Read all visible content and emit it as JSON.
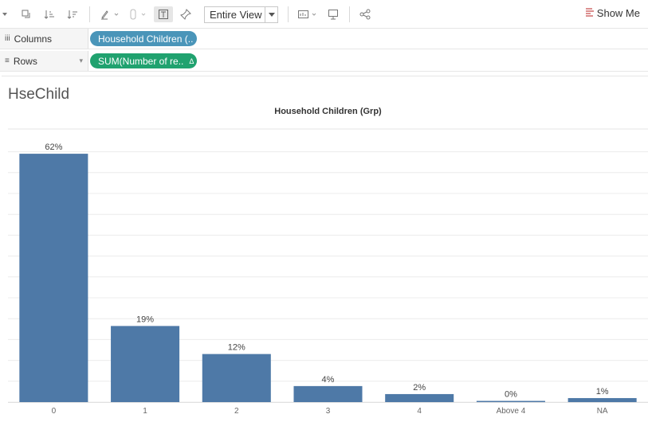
{
  "toolbar": {
    "view_select": "Entire View",
    "show_me": "Show Me",
    "icons": [
      "swap-icon",
      "sort-ascending-icon",
      "sort-descending-icon",
      "highlight-icon",
      "group-icon",
      "label-icon",
      "pin-icon",
      "view-select-icon",
      "presentation-icon",
      "share-icon"
    ]
  },
  "shelves": {
    "columns": {
      "label": "Columns",
      "pill": "Household Children (.."
    },
    "rows": {
      "label": "Rows",
      "pill": "SUM(Number of re..",
      "pill_badge": "Δ"
    }
  },
  "sheet": {
    "title": "HseChild",
    "header": "Household Children (Grp)"
  },
  "colors": {
    "bar": "#4e79a7",
    "pill_blue": "#4a95b9",
    "pill_green": "#20a26f"
  },
  "chart_data": {
    "type": "bar",
    "title": "HseChild",
    "xlabel": "Household Children (Grp)",
    "ylabel": "",
    "categories": [
      "0",
      "1",
      "2",
      "3",
      "4",
      "Above 4",
      "NA"
    ],
    "values": [
      62,
      19,
      12,
      4,
      2,
      0,
      1
    ],
    "data_labels": [
      "62%",
      "19%",
      "12%",
      "4%",
      "2%",
      "0%",
      "1%"
    ],
    "ylim": [
      0,
      65
    ],
    "grid": true,
    "legend": "none"
  }
}
